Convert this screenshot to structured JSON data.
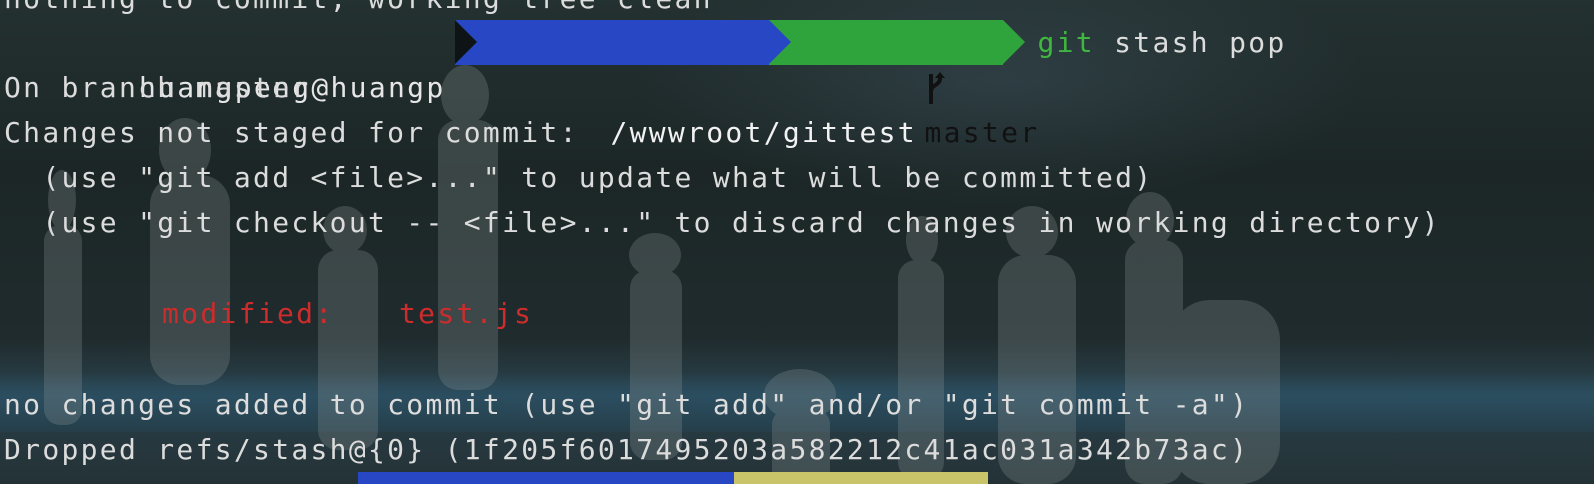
{
  "terminal": {
    "cut_line": "nothing to commit, working tree clean",
    "prompt": {
      "user": "huangpeng@huangp",
      "path": "/wwwroot/gittest",
      "branch": "master",
      "branch_icon": "git-branch-icon",
      "command_keyword": "git",
      "command_rest": " stash pop"
    },
    "lines": [
      "On branch master",
      "Changes not staged for commit:",
      "  (use \"git add <file>...\" to update what will be committed)",
      "  (use \"git checkout -- <file>...\" to discard changes in working directory)"
    ],
    "modified_label": "modified:",
    "modified_file": "test.js",
    "footer_lines": [
      "no changes added to commit (use \"git add\" and/or \"git commit -a\")",
      "Dropped refs/stash@{0} (1f205f6017495203a582212c41ac031a342b73ac)"
    ]
  },
  "colors": {
    "path_segment": "#2747c4",
    "branch_segment": "#2fa33c",
    "git_keyword": "#3fb63f",
    "modified": "#cc2c2c",
    "text": "#dcdcdc"
  }
}
